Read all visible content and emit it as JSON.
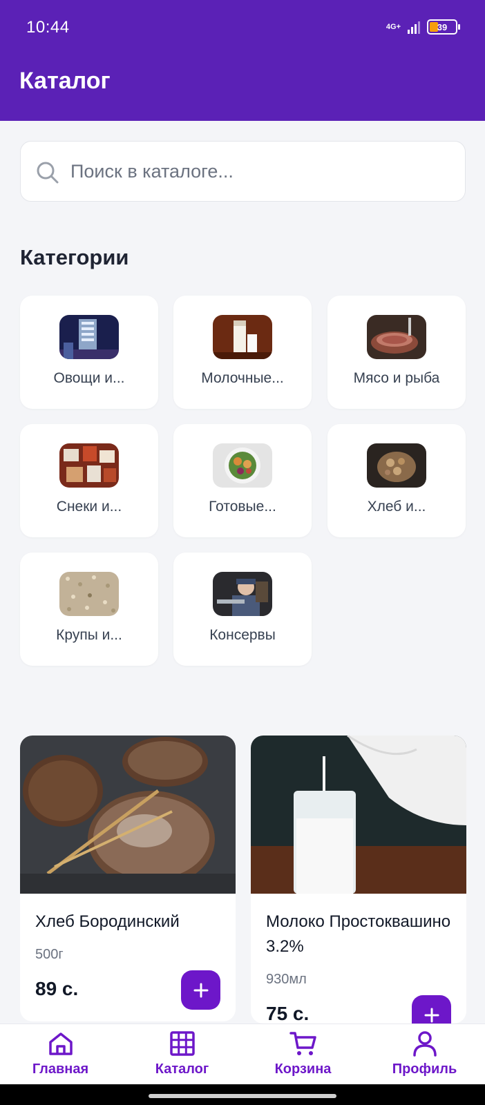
{
  "status_bar": {
    "time": "10:44",
    "network": "4G+",
    "battery": "39"
  },
  "header": {
    "title": "Каталог"
  },
  "search": {
    "placeholder": "Поиск в каталоге..."
  },
  "categories": {
    "title": "Категории",
    "items": [
      {
        "label": "Овощи и..."
      },
      {
        "label": "Молочные..."
      },
      {
        "label": "Мясо и рыба"
      },
      {
        "label": "Снеки и..."
      },
      {
        "label": "Готовые..."
      },
      {
        "label": "Хлеб и..."
      },
      {
        "label": "Крупы и..."
      },
      {
        "label": "Консервы"
      }
    ]
  },
  "products": [
    {
      "name": "Хлеб Бородинский",
      "unit": "500г",
      "price": "89 с.",
      "add_label": "+"
    },
    {
      "name": "Молоко Простоквашино 3.2%",
      "unit": "930мл",
      "price": "75 с.",
      "add_label": "+"
    }
  ],
  "bottom_nav": [
    {
      "label": "Главная",
      "icon": "home-icon"
    },
    {
      "label": "Каталог",
      "icon": "grid-icon"
    },
    {
      "label": "Корзина",
      "icon": "cart-icon"
    },
    {
      "label": "Профиль",
      "icon": "user-icon"
    }
  ],
  "colors": {
    "primary": "#5b21b6",
    "accent": "#6d17c9",
    "background": "#f4f5f8"
  }
}
